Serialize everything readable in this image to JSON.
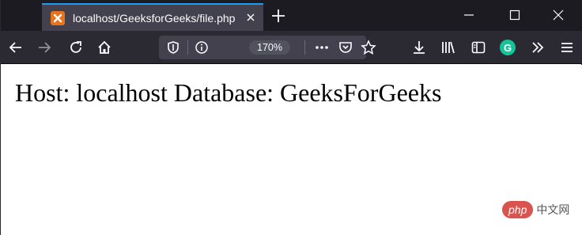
{
  "browser": {
    "tab": {
      "title": "localhost/GeeksforGeeks/file.php",
      "favicon": "xampp-icon"
    },
    "toolbar": {
      "zoom_level": "170%"
    },
    "icons": [
      "back-icon",
      "forward-icon",
      "reload-icon",
      "home-icon",
      "shield-icon",
      "info-icon",
      "more-icon",
      "pocket-icon",
      "bookmark-star-icon",
      "download-icon",
      "library-icon",
      "sidebar-icon",
      "grammarly-icon",
      "overflow-icon",
      "menu-icon"
    ],
    "grammarly_letter": "G"
  },
  "page": {
    "text": "Host: localhost Database: GeeksForGeeks"
  },
  "watermark": {
    "badge": "php",
    "text": "中文网"
  },
  "colors": {
    "tab_accent": "#1d9bf0",
    "toolbar_bg": "#2b2a33",
    "tabstrip_bg": "#1c1b22",
    "grammarly": "#15c39a",
    "favicon": "#e8731c"
  }
}
